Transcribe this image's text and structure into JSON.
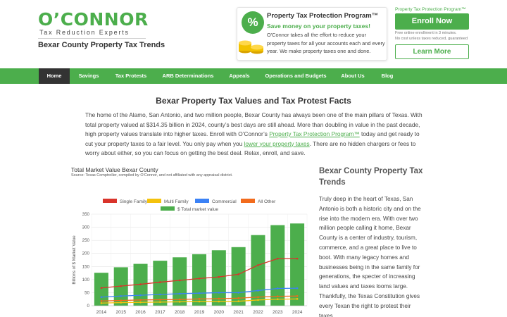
{
  "header": {
    "logo_main": "O’CONNOR",
    "logo_sub": "Tax Reduction Experts",
    "site_title": "Bexar County Property Tax Trends"
  },
  "promo": {
    "badge": "%",
    "title": "Property Tax Protection Program™",
    "subtitle": "Save money on your property taxes!",
    "body": "O'Connor takes all the effort to reduce your property taxes for all your accounts each and every year. We make property taxes one and done."
  },
  "cta": {
    "caption": "Property Tax Protection Program™",
    "enroll_label": "Enroll Now",
    "note1": "Free online enrollment in 3 minutes.",
    "note2": "No cost unless taxes reduced, guaranteed",
    "learn_label": "Learn More"
  },
  "nav": {
    "items": [
      "Home",
      "Savings",
      "Tax Protests",
      "ARB Determinations",
      "Appeals",
      "Operations and Budgets",
      "About Us",
      "Blog"
    ],
    "active": "Home"
  },
  "main": {
    "heading": "Bexar Property Tax Values and Tax Protest Facts",
    "intro_part1": "The home of the Alamo, San Antonio, and two million people, Bexar County has always been one of the main pillars of Texas. With total property valued at $314.35 billion in 2024, county’s best days are still ahead. More than doubling in value in the past decade, high property values translate into higher taxes. Enroll with O’Connor’s ",
    "intro_link1": "Property Tax Protection Program™",
    "intro_part2": " today and get ready to cut your property taxes to a fair level. You only pay when you ",
    "intro_link2": "lower your property taxes",
    "intro_part3": ". There are no hidden chargers or fees to worry about either, so you can focus on getting the best deal. Relax, enroll, and save."
  },
  "chart_header": {
    "title": "Total Market Value Bexar County",
    "source": "Source: Texas Comptroller, compiled by O’Connor, and not affiliated with any appraisal district."
  },
  "sidebar": {
    "title": "Bexar County Property Tax Trends",
    "body": "Truly deep in the heart of Texas, San Antonio is both a historic city and on the rise into the modern era. With over two million people calling it home, Bexar County is a center of industry, tourism, commerce, and a great place to live to boot. With many legacy homes and businesses being in the same family for generations, the specter of increasing land values and taxes looms large. Thankfully, the Texas Constitution gives every Texan the right to protest their taxes."
  },
  "colors": {
    "brand_green": "#4cae4c",
    "single_family": "#d9342b",
    "multi_family": "#f4c20d",
    "commercial": "#3b82f6",
    "all_other": "#f26b1d",
    "total_market": "#4cae4c"
  },
  "chart_data": {
    "type": "bar",
    "title": "Total Market Value Bexar County",
    "xlabel": "",
    "ylabel": "Billions of $ Market Value",
    "ylim": [
      0,
      350
    ],
    "yticks": [
      0,
      50,
      100,
      150,
      200,
      250,
      300,
      350
    ],
    "categories": [
      "2014",
      "2015",
      "2016",
      "2017",
      "2018",
      "2019",
      "2020",
      "2021",
      "2022",
      "2023",
      "2024"
    ],
    "legend": [
      "Single Family",
      "Multi Family",
      "Commercial",
      "All Other",
      "$ Total market value"
    ],
    "legend_position": "top",
    "grid": true,
    "bars": {
      "name": "$ Total market value",
      "values": [
        126,
        147,
        160,
        172,
        185,
        197,
        212,
        224,
        270,
        308,
        314.35
      ]
    },
    "series": [
      {
        "name": "Single Family",
        "type": "line",
        "values": [
          68,
          75,
          82,
          90,
          97,
          104,
          110,
          120,
          155,
          180,
          180
        ]
      },
      {
        "name": "Multi Family",
        "type": "line",
        "values": [
          10,
          12,
          13,
          14,
          15,
          16,
          16,
          17,
          22,
          25,
          26
        ]
      },
      {
        "name": "Commercial",
        "type": "line",
        "values": [
          33,
          37,
          40,
          43,
          46,
          48,
          50,
          50,
          58,
          66,
          67
        ]
      },
      {
        "name": "All Other",
        "type": "line",
        "values": [
          18,
          20,
          22,
          23,
          24,
          26,
          27,
          29,
          33,
          36,
          37
        ]
      }
    ]
  }
}
